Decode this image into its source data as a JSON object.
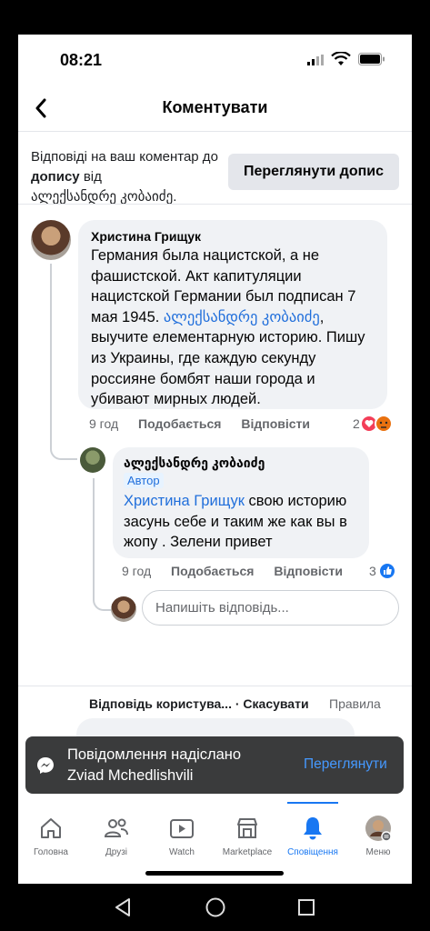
{
  "status_bar": {
    "time": "08:21"
  },
  "header": {
    "title": "Коментувати"
  },
  "notice": {
    "prefix": "Відповіді на ваш коментар до",
    "bold": "допису",
    "suffix": "від",
    "author": "ალექსანდრე კობაიძე.",
    "view_post_label": "Переглянути допис"
  },
  "comment": {
    "author": "Христина Грищук",
    "text_before_mention": "Германия была нацистской, а не фашистской. Акт  капитуляции нацистской Германии был подписан 7 мая 1945. ",
    "mention": "ალექსანდრე კობაიძე",
    "text_after_mention": ", выучите елементарную историю. Пишу из Украины, где каждую секунду россияне бомбят наши города и убивают мирных людей.",
    "time": "9 год",
    "like_label": "Подобається",
    "reply_label": "Відповісти",
    "reaction_count": "2"
  },
  "reply": {
    "author": "ალექსანდრე კობაიძე",
    "badge": "Автор",
    "mention": "Христина Грищук",
    "text": " свою историю засунь себе и таким же как вы в жопу . Зелени привет",
    "time": "9 год",
    "like_label": "Подобається",
    "reply_label": "Відповісти",
    "reaction_count": "3"
  },
  "reply_input": {
    "placeholder": "Напишіть відповідь..."
  },
  "reply_bar": {
    "label": "Відповідь користува...",
    "cancel": "· Скасувати",
    "rules": "Правила"
  },
  "toast": {
    "line1": "Повідомлення надіслано",
    "line2": "Zviad Mchedlishvili",
    "action": "Переглянути"
  },
  "tabs": [
    {
      "label": "Головна",
      "icon": "home-icon"
    },
    {
      "label": "Друзі",
      "icon": "friends-icon"
    },
    {
      "label": "Watch",
      "icon": "watch-icon"
    },
    {
      "label": "Marketplace",
      "icon": "marketplace-icon"
    },
    {
      "label": "Сповіщення",
      "icon": "bell-icon",
      "active": true
    },
    {
      "label": "Меню",
      "icon": "menu-avatar-icon"
    }
  ],
  "colors": {
    "accent": "#1877f2",
    "link": "#216fdb",
    "toast_bg": "#3a3b3c"
  }
}
